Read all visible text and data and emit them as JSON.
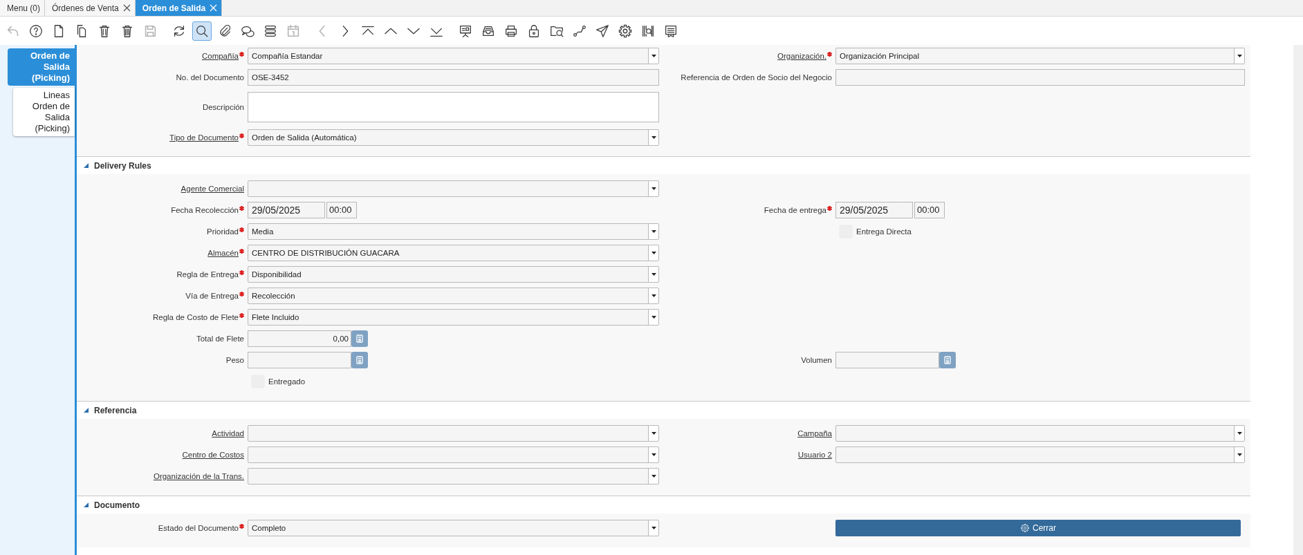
{
  "window_tabs": [
    {
      "label": "Menu (0)",
      "selected": false,
      "closable": false
    },
    {
      "label": "Órdenes de Venta",
      "selected": false,
      "closable": true
    },
    {
      "label": "Orden de Salida",
      "selected": true,
      "closable": true
    }
  ],
  "toolbar": [
    {
      "disabled": true,
      "selected": false
    },
    {
      "disabled": false,
      "selected": false
    },
    {
      "disabled": false,
      "selected": false
    },
    {
      "disabled": false,
      "selected": false
    },
    {
      "disabled": false,
      "selected": false
    },
    {
      "disabled": false,
      "selected": false
    },
    {
      "disabled": true,
      "selected": false
    },
    {
      "disabled": false,
      "selected": false
    },
    {
      "disabled": false,
      "selected": true
    },
    {
      "disabled": false,
      "selected": false
    },
    {
      "disabled": false,
      "selected": false
    },
    {
      "disabled": false,
      "selected": false
    },
    {
      "disabled": true,
      "selected": false
    },
    {
      "disabled": true,
      "selected": false
    },
    {
      "disabled": false,
      "selected": false
    },
    {
      "disabled": false,
      "selected": false
    },
    {
      "disabled": false,
      "selected": false
    },
    {
      "disabled": false,
      "selected": false
    },
    {
      "disabled": false,
      "selected": false
    },
    {
      "disabled": false,
      "selected": false
    },
    {
      "disabled": false,
      "selected": false
    },
    {
      "disabled": false,
      "selected": false
    },
    {
      "disabled": false,
      "selected": false
    },
    {
      "disabled": false,
      "selected": false
    },
    {
      "disabled": false,
      "selected": false
    },
    {
      "disabled": false,
      "selected": false
    },
    {
      "disabled": false,
      "selected": false
    },
    {
      "disabled": false,
      "selected": false
    },
    {
      "disabled": false,
      "selected": false
    }
  ],
  "side_tabs": [
    {
      "label": "Orden de Salida (Picking)",
      "selected": true
    },
    {
      "label": "Lineas Orden de Salida (Picking)",
      "selected": false
    }
  ],
  "sections": [
    {
      "expanded": true,
      "rows": [
        {
          "left": {
            "kind": "select",
            "label": "Compañía",
            "required": true,
            "link": true,
            "value": "Compañía Estandar"
          },
          "right": {
            "kind": "select",
            "label": "Organización.",
            "required": true,
            "link": true,
            "value": "Organización Principal"
          }
        },
        {
          "left": {
            "kind": "text",
            "label": "No. del Documento",
            "required": false,
            "link": false,
            "value": "OSE-3452"
          },
          "right": {
            "kind": "text",
            "label": "Referencia de Orden de Socio del Negocio",
            "required": false,
            "link": false
          }
        },
        {
          "left": {
            "kind": "textarea",
            "label": "Descripción",
            "required": false,
            "link": false
          }
        },
        {
          "left": {
            "kind": "select",
            "label": "Tipo de Documento",
            "required": true,
            "link": true,
            "value": "Orden de Salida (Automática)"
          }
        }
      ]
    },
    {
      "title": "Delivery Rules",
      "expanded": true,
      "rows": [
        {
          "left": {
            "kind": "select",
            "label": "Agente Comercial",
            "required": false,
            "link": true
          }
        },
        {
          "left": {
            "kind": "date_time",
            "label": "Fecha Recolección",
            "required": true,
            "link": false,
            "date": "29/05/2025",
            "time": "00:00"
          },
          "right": {
            "kind": "date_time",
            "label": "Fecha de entrega",
            "required": true,
            "link": false,
            "date": "29/05/2025",
            "time": "00:00"
          }
        },
        {
          "left": {
            "kind": "select",
            "label": "Prioridad",
            "required": true,
            "link": false,
            "value": "Media"
          },
          "right": {
            "kind": "checkbox",
            "label": "Entrega Directa",
            "checked": false
          }
        },
        {
          "left": {
            "kind": "select",
            "label": "Almacén",
            "required": true,
            "link": true,
            "value": "CENTRO DE DISTRIBUCIÓN GUACARA"
          }
        },
        {
          "left": {
            "kind": "select",
            "label": "Regla de Entrega",
            "required": true,
            "link": false,
            "value": "Disponibilidad"
          }
        },
        {
          "left": {
            "kind": "select",
            "label": "Vía de Entrega",
            "required": true,
            "link": false,
            "value": "Recolección"
          }
        },
        {
          "left": {
            "kind": "select",
            "label": "Regla de Costo de Flete",
            "required": true,
            "link": false,
            "value": "Flete Incluido"
          }
        },
        {
          "left": {
            "kind": "number",
            "label": "Total de Flete",
            "required": false,
            "link": false,
            "value": "0,00"
          }
        },
        {
          "left": {
            "kind": "number",
            "label": "Peso",
            "required": false,
            "link": false
          },
          "right": {
            "kind": "number",
            "label": "Volumen",
            "required": false,
            "link": false
          }
        },
        {
          "left": {
            "kind": "checkbox",
            "label": "Entregado",
            "checked": false
          }
        }
      ]
    },
    {
      "title": "Referencia",
      "expanded": true,
      "rows": [
        {
          "left": {
            "kind": "select",
            "label": "Actividad",
            "required": false,
            "link": true
          },
          "right": {
            "kind": "select",
            "label": "Campaña",
            "required": false,
            "link": true
          }
        },
        {
          "left": {
            "kind": "select",
            "label": "Centro de Costos",
            "required": false,
            "link": true
          },
          "right": {
            "kind": "select",
            "label": "Usuario 2",
            "required": false,
            "link": true
          }
        },
        {
          "left": {
            "kind": "select",
            "label": "Organización de la Trans.",
            "required": false,
            "link": true
          }
        }
      ]
    },
    {
      "title": "Documento",
      "expanded": true,
      "rows": [
        {
          "left": {
            "kind": "select",
            "label": "Estado del Documento",
            "required": true,
            "link": false,
            "value": "Completo"
          },
          "right": {
            "kind": "button",
            "label": "Cerrar"
          }
        }
      ]
    }
  ]
}
